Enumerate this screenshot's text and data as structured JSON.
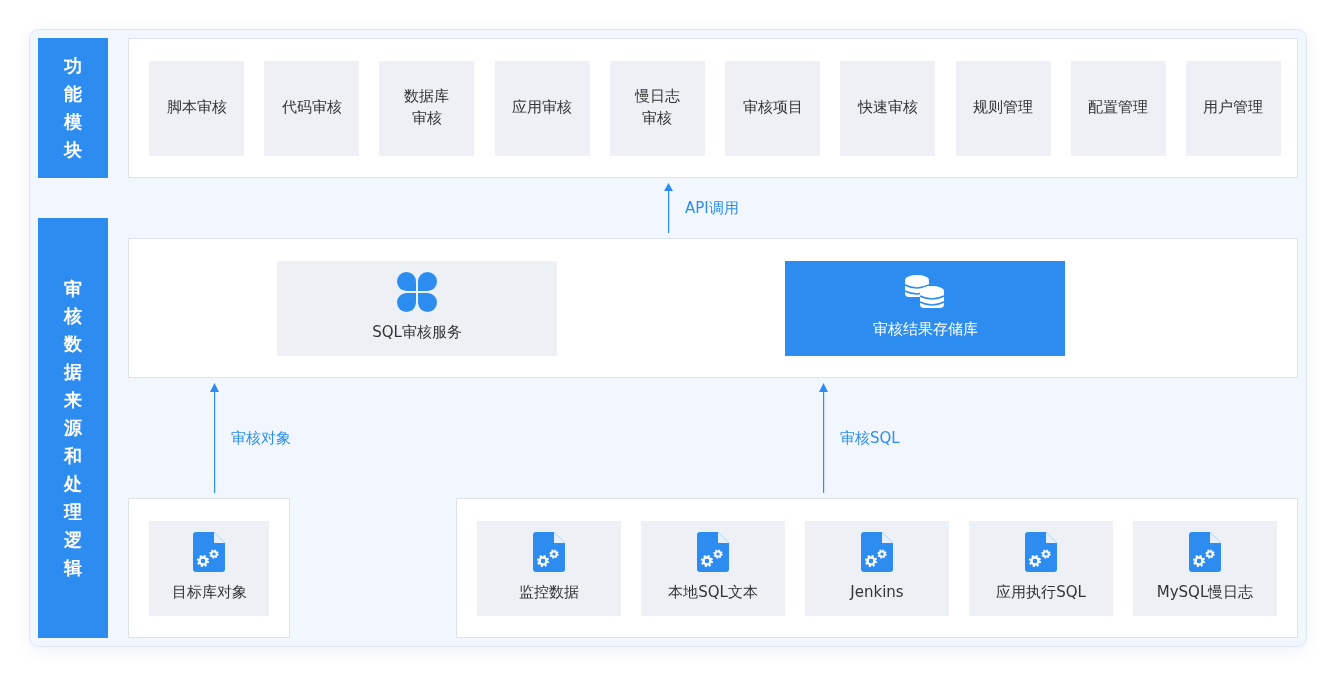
{
  "sections": [
    {
      "label": "功能模块"
    },
    {
      "label": "审核数据来源和处理逻辑"
    }
  ],
  "modules": [
    {
      "label": "脚本审核"
    },
    {
      "label": "代码审核"
    },
    {
      "label": "数据库审核"
    },
    {
      "label": "应用审核"
    },
    {
      "label": "慢日志审核"
    },
    {
      "label": "审核项目"
    },
    {
      "label": "快速审核"
    },
    {
      "label": "规则管理"
    },
    {
      "label": "配置管理"
    },
    {
      "label": "用户管理"
    }
  ],
  "api_connector": {
    "label": "API调用"
  },
  "services": [
    {
      "kind": "service",
      "label": "SQL审核服务"
    },
    {
      "kind": "database",
      "label": "审核结果存储库"
    }
  ],
  "connectors": [
    {
      "label": "审核对象"
    },
    {
      "label": "审核SQL"
    }
  ],
  "source_groups": [
    {
      "items": [
        {
          "label": "目标库对象"
        }
      ]
    },
    {
      "items": [
        {
          "label": "监控数据"
        },
        {
          "label": "本地SQL文本"
        },
        {
          "label": "Jenkins"
        },
        {
          "label": "应用执行SQL"
        },
        {
          "label": "MySQL慢日志"
        }
      ]
    }
  ]
}
